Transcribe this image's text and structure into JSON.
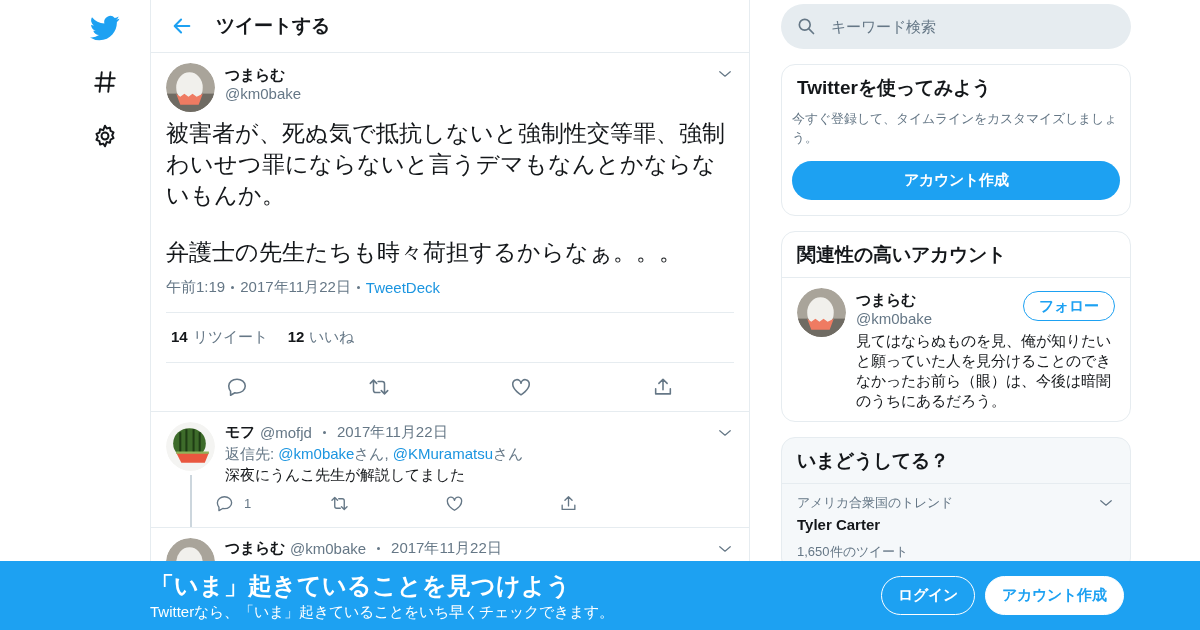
{
  "nav": [
    {
      "kind": "logo"
    },
    {
      "kind": "explore"
    },
    {
      "kind": "settings"
    }
  ],
  "header": {
    "title": "ツイートする"
  },
  "tweet": {
    "name": "つまらむ",
    "handle": "@km0bake",
    "paragraphs": [
      "被害者が、死ぬ気で抵抗しないと強制性交等罪、強制わいせつ罪にならないと言うデマもなんとかならないもんか。",
      "弁護士の先生たちも時々荷担するからなぁ。。。"
    ],
    "time": "午前1:19",
    "date": "2017年11月22日",
    "source": "TweetDeck",
    "stats": [
      {
        "count": "14",
        "label": "リツイート"
      },
      {
        "count": "12",
        "label": "いいね"
      }
    ]
  },
  "replies": [
    {
      "name": "モフ",
      "handle": "@mofjd",
      "date": "2017年11月22日",
      "reply_to": {
        "prefix": "返信先: ",
        "mentions": [
          {
            "handle": "@km0bake",
            "suffix": "さん, "
          },
          {
            "handle": "@KMuramatsu",
            "suffix": "さん"
          }
        ]
      },
      "text": "深夜にうんこ先生が解説してました",
      "reply_count": "1",
      "thread": true
    },
    {
      "name": "つまらむ",
      "handle": "@km0bake",
      "date": "2017年11月22日",
      "thread": false
    }
  ],
  "search": {
    "placeholder": "キーワード検索"
  },
  "signup_card": {
    "title": "Twitterを使ってみよう",
    "text": "今すぐ登録して、タイムラインをカスタマイズしましょう。",
    "button": "アカウント作成"
  },
  "related": {
    "title": "関連性の高いアカウント",
    "accounts": [
      {
        "name": "つまらむ",
        "handle": "@km0bake",
        "bio": "見てはならぬものを見、俺が知りたいと願っていた人を見分けることのできなかったお前ら（眼）は、今後は暗闇のうちにあるだろう。",
        "button": "フォロー"
      }
    ]
  },
  "trends": {
    "title": "いまどうしてる？",
    "items": [
      {
        "context": "アメリカ合衆国のトレンド",
        "name": "Tyler Carter",
        "count": "1,650件のツイート"
      }
    ]
  },
  "banner": {
    "title": "「いま」起きていることを見つけよう",
    "text": "Twitterなら、「いま」起きていることをいち早くチェックできます。",
    "buttons": [
      {
        "label": "ログイン",
        "kind": "outline"
      },
      {
        "label": "アカウント作成",
        "kind": "filled"
      }
    ]
  }
}
